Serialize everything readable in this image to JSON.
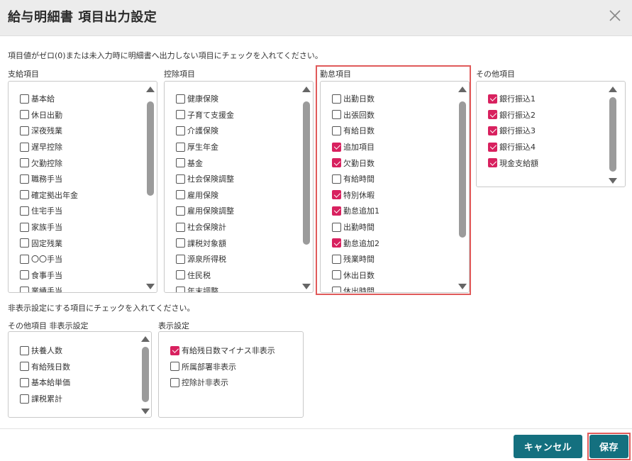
{
  "dialog": {
    "title": "給与明細書 項目出力設定"
  },
  "notes": {
    "output_instruction": "項目値がゼロ(0)または未入力時に明細書へ出力しない項目にチェックを入れてください。",
    "hide_instruction": "非表示設定にする項目にチェックを入れてください。"
  },
  "panels": {
    "payment": {
      "label": "支給項目",
      "items": [
        {
          "label": "基本給",
          "checked": false
        },
        {
          "label": "休日出勤",
          "checked": false
        },
        {
          "label": "深夜残業",
          "checked": false
        },
        {
          "label": "遅早控除",
          "checked": false
        },
        {
          "label": "欠勤控除",
          "checked": false
        },
        {
          "label": "職務手当",
          "checked": false
        },
        {
          "label": "確定拠出年金",
          "checked": false
        },
        {
          "label": "住宅手当",
          "checked": false
        },
        {
          "label": "家族手当",
          "checked": false
        },
        {
          "label": "固定残業",
          "checked": false
        },
        {
          "label": "〇〇手当",
          "checked": false
        },
        {
          "label": "食事手当",
          "checked": false
        },
        {
          "label": "業績手当",
          "checked": false
        }
      ]
    },
    "deduction": {
      "label": "控除項目",
      "items": [
        {
          "label": "健康保険",
          "checked": false
        },
        {
          "label": "子育て支援金",
          "checked": false
        },
        {
          "label": "介護保険",
          "checked": false
        },
        {
          "label": "厚生年金",
          "checked": false
        },
        {
          "label": "基金",
          "checked": false
        },
        {
          "label": "社会保険調整",
          "checked": false
        },
        {
          "label": "雇用保険",
          "checked": false
        },
        {
          "label": "雇用保険調整",
          "checked": false
        },
        {
          "label": "社会保険計",
          "checked": false
        },
        {
          "label": "課税対象額",
          "checked": false
        },
        {
          "label": "源泉所得税",
          "checked": false
        },
        {
          "label": "住民税",
          "checked": false
        },
        {
          "label": "年末調整",
          "checked": false
        }
      ]
    },
    "attendance": {
      "label": "勤怠項目",
      "items": [
        {
          "label": "出勤日数",
          "checked": false
        },
        {
          "label": "出張回数",
          "checked": false
        },
        {
          "label": "有給日数",
          "checked": false
        },
        {
          "label": "追加項目",
          "checked": true
        },
        {
          "label": "欠勤日数",
          "checked": true
        },
        {
          "label": "有給時間",
          "checked": false
        },
        {
          "label": "特別休暇",
          "checked": true
        },
        {
          "label": "勤怠追加1",
          "checked": true
        },
        {
          "label": "出勤時間",
          "checked": false
        },
        {
          "label": "勤怠追加2",
          "checked": true
        },
        {
          "label": "残業時間",
          "checked": false
        },
        {
          "label": "休出日数",
          "checked": false
        },
        {
          "label": "休出時間",
          "checked": false
        }
      ]
    },
    "other": {
      "label": "その他項目",
      "items": [
        {
          "label": "銀行振込1",
          "checked": true
        },
        {
          "label": "銀行振込2",
          "checked": true
        },
        {
          "label": "銀行振込3",
          "checked": true
        },
        {
          "label": "銀行振込4",
          "checked": true
        },
        {
          "label": "現金支給額",
          "checked": true
        }
      ]
    },
    "other_hidden": {
      "label": "その他項目 非表示設定",
      "items": [
        {
          "label": "扶養人数",
          "checked": false
        },
        {
          "label": "有給残日数",
          "checked": false
        },
        {
          "label": "基本給単価",
          "checked": false
        },
        {
          "label": "課税累計",
          "checked": false
        }
      ]
    },
    "display": {
      "label": "表示設定",
      "items": [
        {
          "label": "有給残日数マイナス非表示",
          "checked": true
        },
        {
          "label": "所属部署非表示",
          "checked": false
        },
        {
          "label": "控除計非表示",
          "checked": false
        }
      ]
    }
  },
  "buttons": {
    "cancel": "キャンセル",
    "save": "保存"
  },
  "colors": {
    "accent": "#d8215f",
    "primary_button": "#14707f",
    "highlight": "#e05a5a"
  },
  "icons": {
    "close": "close-icon",
    "scroll_up": "scroll-up-arrow-icon",
    "scroll_down": "scroll-down-arrow-icon"
  }
}
